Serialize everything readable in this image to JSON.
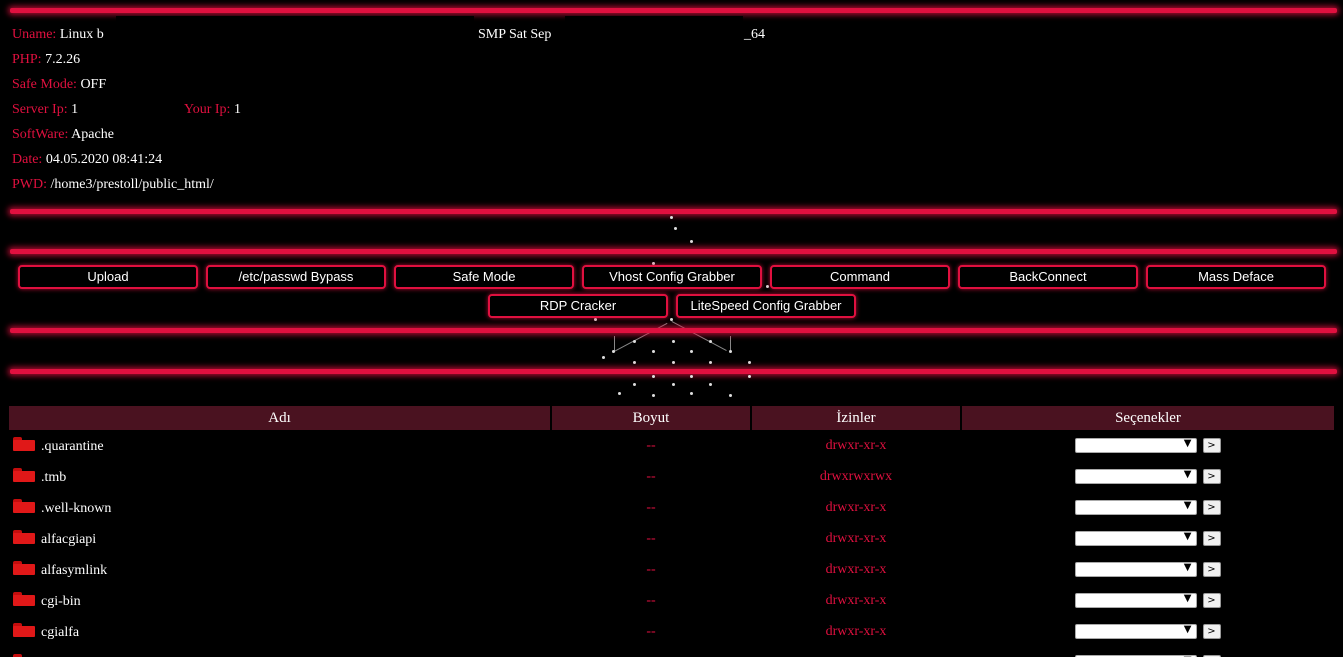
{
  "server_info": {
    "uname": {
      "label": "Uname:",
      "value_a": "Linux b",
      "value_b": "SMP Sat Sep",
      "value_c": "_64"
    },
    "php": {
      "label": "PHP:",
      "value": "7.2.26"
    },
    "safe_mode": {
      "label": "Safe Mode:",
      "value": "OFF"
    },
    "server_ip": {
      "label": "Server Ip:",
      "value": "1"
    },
    "your_ip": {
      "label": "Your Ip:",
      "value": "1"
    },
    "software": {
      "label": "SoftWare:",
      "value": "Apache"
    },
    "date": {
      "label": "Date:",
      "value": "04.05.2020 08:41:24"
    },
    "pwd": {
      "label": "PWD:",
      "value": "/home3/prestoll/public_html/"
    }
  },
  "menu": {
    "row1": [
      "Upload",
      "/etc/passwd Bypass",
      "Safe Mode",
      "Vhost Config Grabber",
      "Command",
      "BackConnect",
      "Mass Deface"
    ],
    "row2": [
      "RDP Cracker",
      "LiteSpeed Config Grabber"
    ]
  },
  "table": {
    "headers": {
      "name": "Adı",
      "size": "Boyut",
      "perms": "İzinler",
      "options": "Seçenekler"
    },
    "rows": [
      {
        "name": ".quarantine",
        "size": "--",
        "perms": "drwxr-xr-x"
      },
      {
        "name": ".tmb",
        "size": "--",
        "perms": "drwxrwxrwx"
      },
      {
        "name": ".well-known",
        "size": "--",
        "perms": "drwxr-xr-x"
      },
      {
        "name": "alfacgiapi",
        "size": "--",
        "perms": "drwxr-xr-x"
      },
      {
        "name": "alfasymlink",
        "size": "--",
        "perms": "drwxr-xr-x"
      },
      {
        "name": "cgi-bin",
        "size": "--",
        "perms": "drwxr-xr-x"
      },
      {
        "name": "cgialfa",
        "size": "--",
        "perms": "drwxr-xr-x"
      },
      {
        "name": "",
        "size": "",
        "perms": ""
      }
    ],
    "go_label": ">"
  },
  "colors": {
    "accent": "#e0103f",
    "header_bg": "#4a1220",
    "folder": "#e01818"
  }
}
